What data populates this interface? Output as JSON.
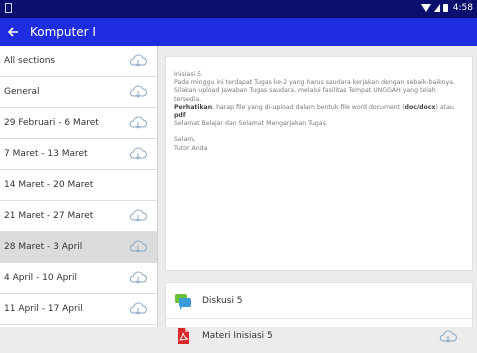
{
  "status": {
    "time": "4:58"
  },
  "appbar": {
    "title": "Komputer I"
  },
  "sections": [
    {
      "label": "All sections",
      "download": true
    },
    {
      "label": "General",
      "download": true
    },
    {
      "label": "29 Februari - 6 Maret",
      "download": true
    },
    {
      "label": "7 Maret - 13 Maret",
      "download": true
    },
    {
      "label": "14 Maret - 20 Maret",
      "download": false
    },
    {
      "label": "21 Maret - 27 Maret",
      "download": true
    },
    {
      "label": "28 Maret - 3 April",
      "download": true,
      "active": true
    },
    {
      "label": "4 April - 10 April",
      "download": true
    },
    {
      "label": "11 April - 17 April",
      "download": true
    }
  ],
  "summary": {
    "heading": "Inisiasi 5",
    "body": "Pada minggu ini terdapat Tugas ke-2 yang harus saudara kerjakan dengan sebaik-baiknya. Silakan upload Jawaban Tugas saudara, melalui fasilitas Tempat UNGGAH yang telah tersedia.",
    "note_bold": "Perhatikan",
    "note_text": ", harap file yang di-upload dalam bentuk file word document (",
    "note_ext1": "doc/docx",
    "note_mid": ") atau ",
    "note_ext2": "pdf",
    "closing": "Selamat Belajar dan Selamat Mengerjakan Tugas.",
    "greeting": "Salam,",
    "signature": "Tutor Anda"
  },
  "activities": [
    {
      "label": "Diskusi 5",
      "icon": "forum-icon"
    },
    {
      "label": "Materi Inisiasi 5",
      "icon": "pdf-icon",
      "download": true
    }
  ],
  "colors": {
    "appbar": "#1e2de0",
    "statusbar": "#0a0f6e",
    "active_row": "#dcdcdc"
  }
}
